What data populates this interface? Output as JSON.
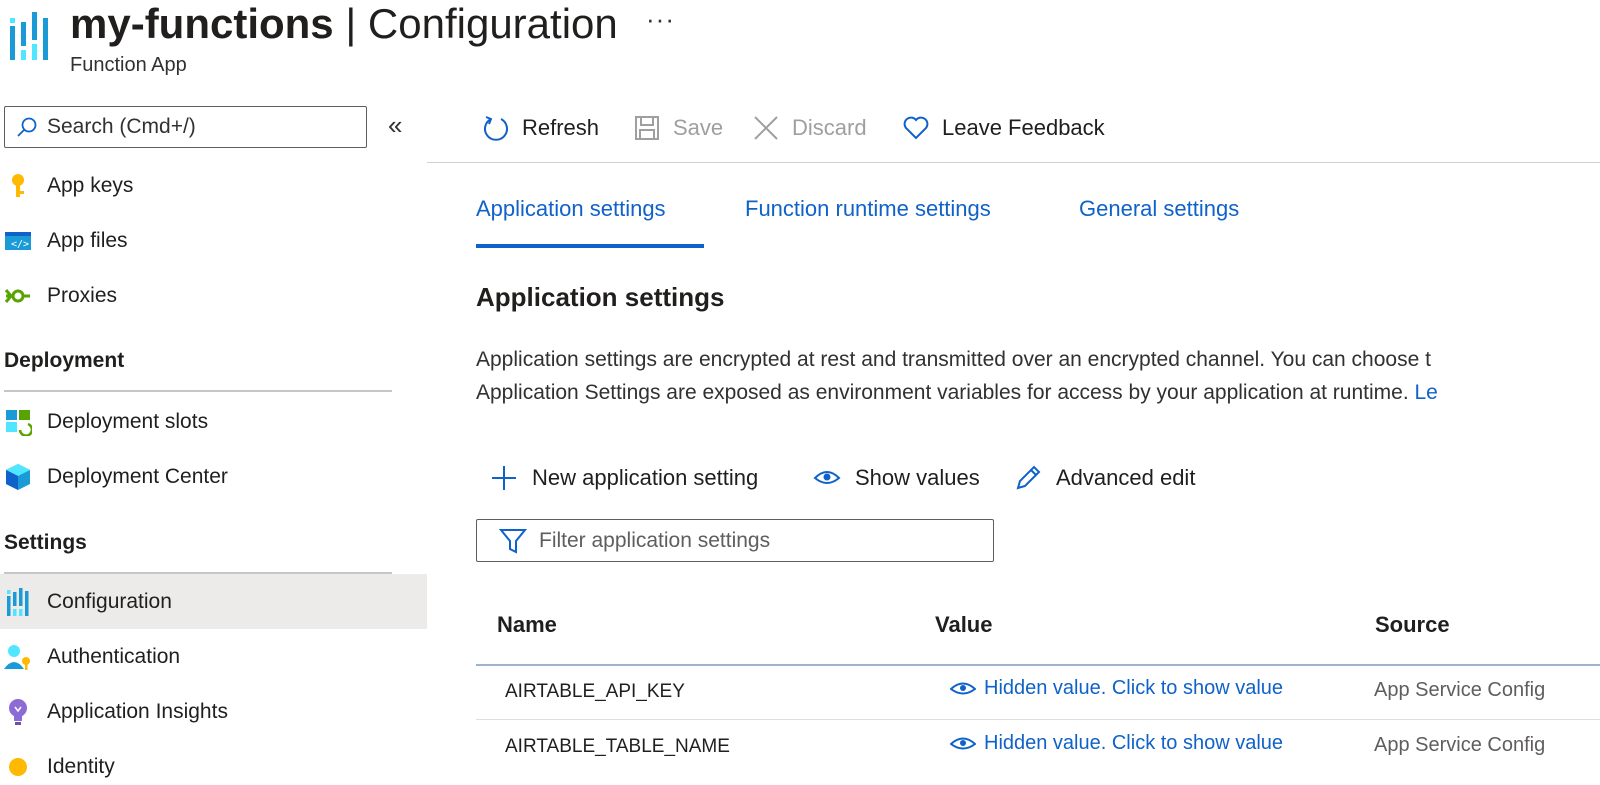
{
  "header": {
    "resource_name": "my-functions",
    "separator": " | ",
    "page_name": "Configuration",
    "more": "···",
    "subtitle": "Function App"
  },
  "sidebar": {
    "search_placeholder": "Search (Cmd+/)",
    "collapse_label": "«",
    "items_top": [
      {
        "label": "App keys",
        "icon": "key-icon"
      },
      {
        "label": "App files",
        "icon": "code-file-icon"
      },
      {
        "label": "Proxies",
        "icon": "proxy-icon"
      }
    ],
    "section_deployment": "Deployment",
    "items_deployment": [
      {
        "label": "Deployment slots",
        "icon": "deployment-slots-icon"
      },
      {
        "label": "Deployment Center",
        "icon": "deployment-center-icon"
      }
    ],
    "section_settings": "Settings",
    "items_settings": [
      {
        "label": "Configuration",
        "icon": "configuration-icon",
        "selected": true
      },
      {
        "label": "Authentication",
        "icon": "authentication-icon"
      },
      {
        "label": "Application Insights",
        "icon": "lightbulb-icon"
      },
      {
        "label": "Identity",
        "icon": "identity-icon"
      }
    ]
  },
  "toolbar": {
    "refresh": "Refresh",
    "save": "Save",
    "discard": "Discard",
    "feedback": "Leave Feedback"
  },
  "tabs": [
    {
      "label": "Application settings",
      "active": true
    },
    {
      "label": "Function runtime settings",
      "active": false
    },
    {
      "label": "General settings",
      "active": false
    }
  ],
  "main": {
    "section_title": "Application settings",
    "desc_line1": "Application settings are encrypted at rest and transmitted over an encrypted channel. You can choose t",
    "desc_line2": "Application Settings are exposed as environment variables for access by your application at runtime. ",
    "desc_link": "Le",
    "actions": {
      "new_setting": "New application setting",
      "show_values": "Show values",
      "advanced_edit": "Advanced edit"
    },
    "filter_placeholder": "Filter application settings"
  },
  "table": {
    "columns": [
      "Name",
      "Value",
      "Source"
    ],
    "rows": [
      {
        "name": "AIRTABLE_API_KEY",
        "value": "Hidden value. Click to show value",
        "source": "App Service Config"
      },
      {
        "name": "AIRTABLE_TABLE_NAME",
        "value": "Hidden value. Click to show value",
        "source": "App Service Config"
      }
    ]
  },
  "colors": {
    "accent": "#0f62c9",
    "selected_bg": "#edebe9"
  }
}
